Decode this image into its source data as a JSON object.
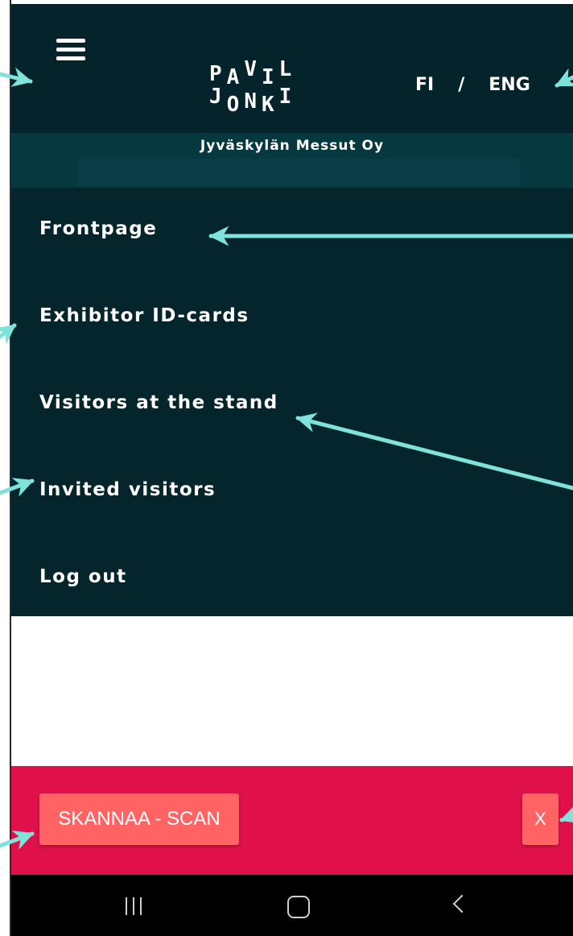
{
  "header": {
    "logo_row1": [
      "P",
      "A",
      "V",
      "I",
      "L"
    ],
    "logo_row2": [
      "J",
      "O",
      "N",
      "K",
      "I"
    ],
    "lang_fi": "FI",
    "lang_sep": "/",
    "lang_eng": "ENG"
  },
  "company": {
    "name": "Jyväskylän Messut Oy"
  },
  "menu": {
    "items": [
      {
        "label": "Frontpage"
      },
      {
        "label": "Exhibitor ID-cards"
      },
      {
        "label": "Visitors at the stand"
      },
      {
        "label": "Invited visitors"
      },
      {
        "label": "Log out"
      }
    ]
  },
  "bottom_bar": {
    "scan_label": "SKANNAA - SCAN",
    "close_label": "X"
  },
  "colors": {
    "header_bg": "#05232b",
    "menu_bg": "#03252b",
    "bottom_bar_bg": "#e0114a",
    "button_bg": "#ff6364",
    "annotation_arrow": "#7fe3dc"
  },
  "icons": {
    "menu": "hamburger-icon",
    "nav_recent": "recent-apps-icon",
    "nav_home": "home-icon",
    "nav_back": "back-icon"
  }
}
